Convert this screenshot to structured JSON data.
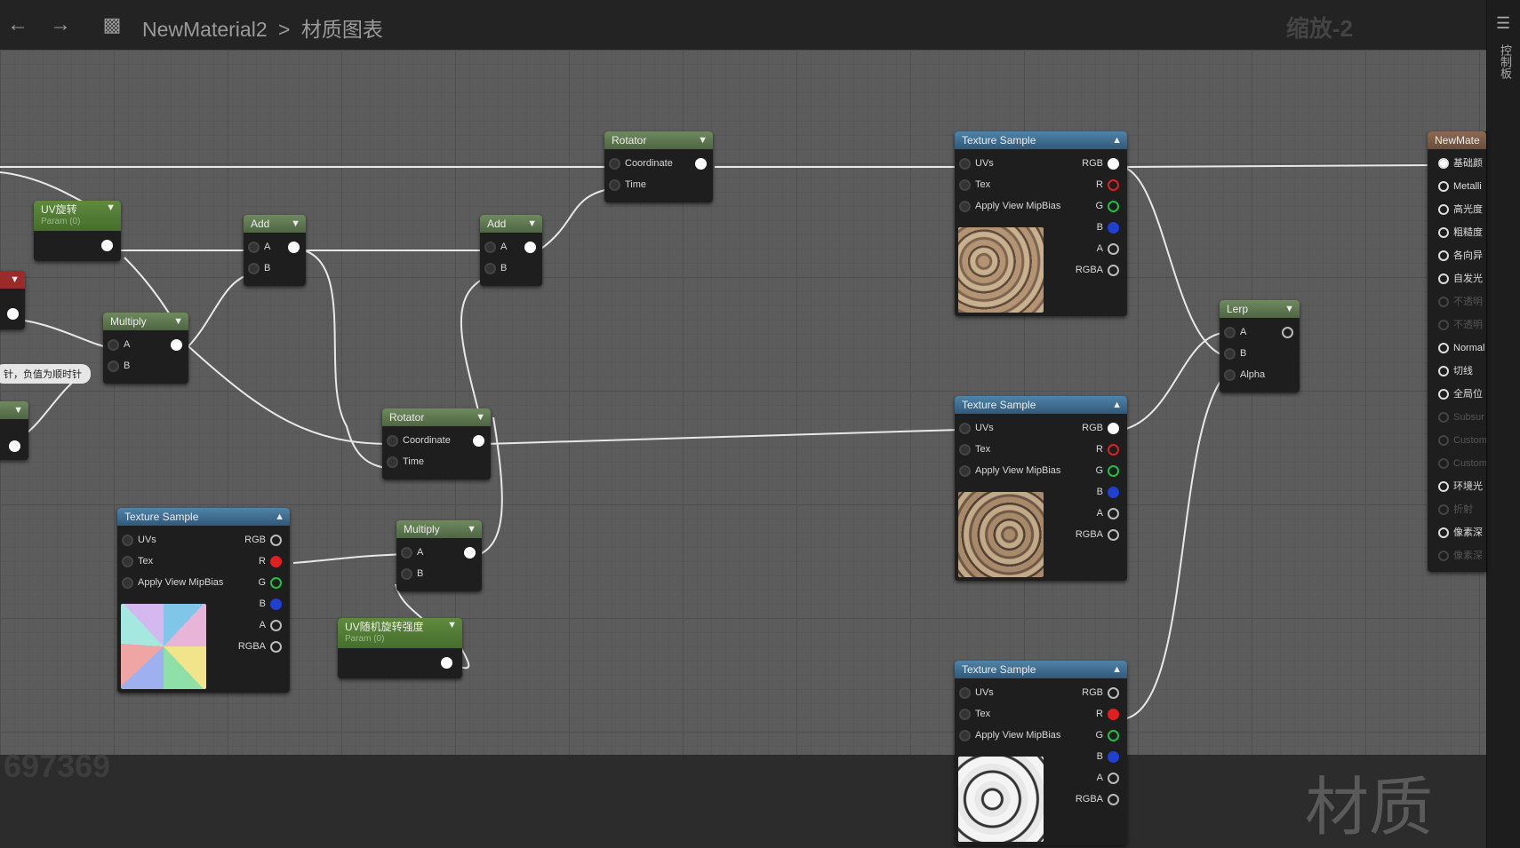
{
  "breadcrumb": {
    "asset": "NewMaterial2",
    "separator": ">",
    "graph": "材质图表"
  },
  "zoom_label": "缩放-2",
  "right_panel_label": "控制板",
  "watermark": {
    "corner": "材质",
    "number": "697369"
  },
  "tooltip": "针，负值为顺时针",
  "nodes": {
    "uv_rotate": {
      "title": "UV旋转",
      "subtitle": "Param (0)"
    },
    "uv_random": {
      "title": "UV随机旋转强度",
      "subtitle": "Param (0)"
    },
    "add1": {
      "title": "Add",
      "pins": [
        "A",
        "B"
      ]
    },
    "add2": {
      "title": "Add",
      "pins": [
        "A",
        "B"
      ]
    },
    "multiply1": {
      "title": "Multiply",
      "pins": [
        "A",
        "B"
      ]
    },
    "multiply2": {
      "title": "Multiply",
      "pins": [
        "A",
        "B"
      ]
    },
    "rotator1": {
      "title": "Rotator",
      "pins": [
        "Coordinate",
        "Time"
      ]
    },
    "rotator2": {
      "title": "Rotator",
      "pins": [
        "Coordinate",
        "Time"
      ]
    },
    "lerp": {
      "title": "Lerp",
      "pins": [
        "A",
        "B",
        "Alpha"
      ]
    },
    "texture_sample": {
      "title": "Texture Sample",
      "inputs": [
        "UVs",
        "Tex",
        "Apply View MipBias"
      ],
      "outputs": [
        "RGB",
        "R",
        "G",
        "B",
        "A",
        "RGBA"
      ]
    },
    "result": {
      "title": "NewMate",
      "pins": [
        "基础颜",
        "Metalli",
        "高光度",
        "粗糙度",
        "各向异",
        "自发光",
        "不透明",
        "不透明",
        "Normal",
        "切线",
        "全局位",
        "Subsur",
        "Custom",
        "Custom",
        "环境光",
        "折射",
        "像素深",
        "像素深"
      ]
    }
  },
  "colors": {
    "grid": "#5c5c5c",
    "wire": "#ffffff",
    "pin_r": "#e02020",
    "pin_g": "#20c040",
    "pin_b": "#2040d0"
  }
}
